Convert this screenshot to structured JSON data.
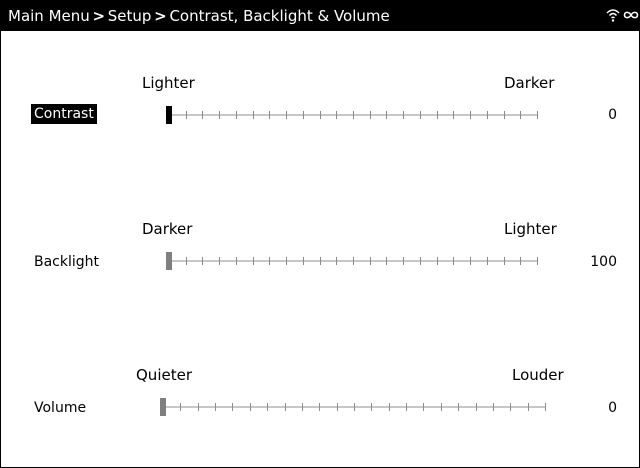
{
  "header": {
    "breadcrumb": [
      "Main Menu",
      "Setup",
      "Contrast, Backlight & Volume"
    ],
    "separator": ">",
    "icons": [
      "wifi-icon",
      "infinity-icon"
    ]
  },
  "colors": {
    "background": "#ffffff",
    "text": "#000000",
    "titlebar": "#000000",
    "selected_handle": "#000000",
    "handle": "#7f7f7f",
    "track": "#8c8c8c"
  },
  "settings": {
    "contrast": {
      "label": "Contrast",
      "min_label": "Lighter",
      "max_label": "Darker",
      "value": "0",
      "level": 0,
      "selected": true
    },
    "backlight": {
      "label": "Backlight",
      "min_label": "Darker",
      "max_label": "Lighter",
      "value": "100",
      "level": 0,
      "selected": false
    },
    "volume": {
      "label": "Volume",
      "min_label": "Quieter",
      "max_label": "Louder",
      "value": "0",
      "level": 0,
      "selected": false
    }
  }
}
